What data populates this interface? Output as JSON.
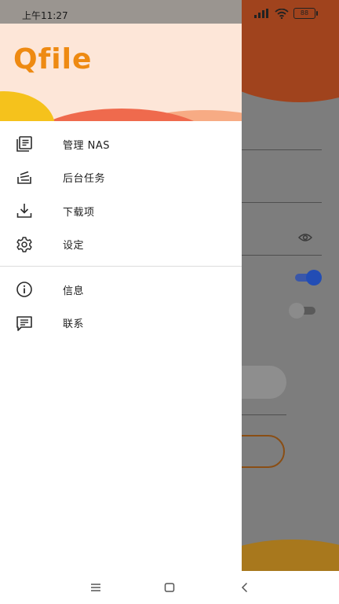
{
  "status_bar": {
    "time": "上午11:27",
    "battery": "88",
    "icons": [
      "signal-icon",
      "wifi-icon",
      "battery-icon"
    ]
  },
  "drawer": {
    "logo": "Qfile",
    "items": [
      {
        "label": "管理 NAS",
        "icon": "manage-nas-icon"
      },
      {
        "label": "后台任务",
        "icon": "background-tasks-icon"
      },
      {
        "label": "下载项",
        "icon": "download-icon"
      },
      {
        "label": "设定",
        "icon": "gear-icon"
      }
    ],
    "secondary_items": [
      {
        "label": "信息",
        "icon": "info-icon"
      },
      {
        "label": "联系",
        "icon": "message-icon"
      }
    ]
  },
  "nav_bar": {
    "buttons": [
      "menu-icon",
      "home-icon",
      "back-icon"
    ]
  },
  "colors": {
    "brand_orange": "#ee8a12",
    "accent_blue": "#224db5",
    "header_bg": "#fde6d8"
  }
}
